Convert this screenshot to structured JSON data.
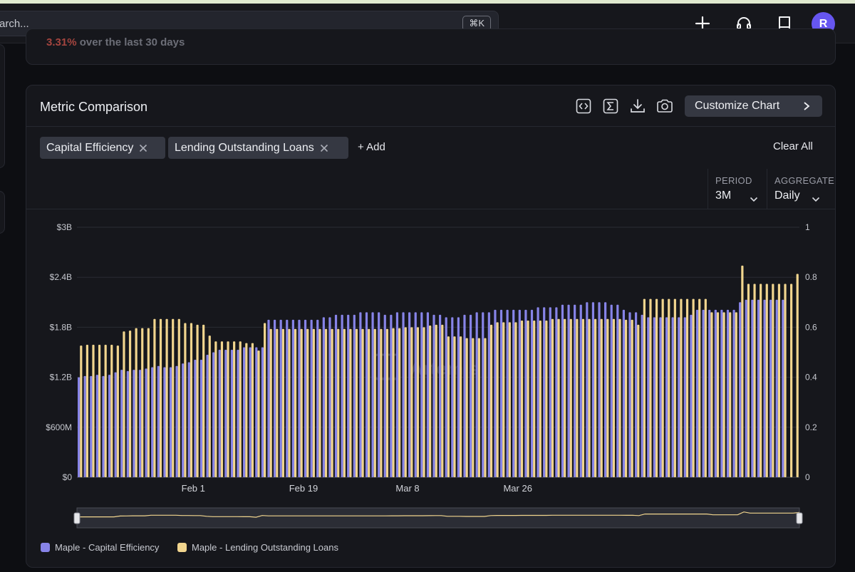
{
  "topbar": {
    "search_placeholder": "arch...",
    "shortcut": "⌘K",
    "avatar_initial": "R",
    "icons": [
      "plus-icon",
      "headset-icon",
      "book-icon"
    ]
  },
  "summary": {
    "change": "3.31%",
    "change_suffix": "over the last 30 days"
  },
  "card": {
    "title": "Metric Comparison",
    "toolbar_icons": [
      "embed-icon",
      "sigma-icon",
      "download-icon",
      "camera-icon"
    ],
    "customize_label": "Customize Chart",
    "metrics": [
      {
        "label": "Capital Efficiency"
      },
      {
        "label": "Lending Outstanding Loans"
      }
    ],
    "add_label": "+ Add",
    "clear_label": "Clear All",
    "period": {
      "label": "PERIOD",
      "value": "3M"
    },
    "aggregate": {
      "label": "AGGREGATE",
      "value": "Daily"
    }
  },
  "colors": {
    "capital_efficiency": "#8784e8",
    "lending_loans": "#f1d58e",
    "negative": "#a5453f",
    "accent": "#6656f0"
  },
  "chart_data": {
    "type": "bar",
    "dual_axis": true,
    "aggregation": "Daily",
    "left_axis": {
      "ticks": [
        "$0",
        "$600M",
        "$1.2B",
        "$1.8B",
        "$2.4B",
        "$3B"
      ],
      "ylim": [
        0,
        3000000000
      ]
    },
    "right_axis": {
      "ticks": [
        "0",
        "0.2",
        "0.4",
        "0.6",
        "0.8",
        "1"
      ],
      "ylim": [
        0,
        1
      ]
    },
    "x_tick_labels": [
      {
        "label": "Feb 1",
        "index": 18
      },
      {
        "label": "Feb 19",
        "index": 36
      },
      {
        "label": "Mar 8",
        "index": 53
      },
      {
        "label": "Mar 26",
        "index": 71
      }
    ],
    "grid": true,
    "legend_position": "bottom-left",
    "watermark": "Artemis",
    "series": [
      {
        "name": "Maple - Capital Efficiency",
        "axis": "right",
        "values": [
          0.4,
          0.405,
          0.405,
          0.41,
          0.405,
          0.41,
          0.42,
          0.43,
          0.425,
          0.43,
          0.43,
          0.435,
          0.44,
          0.445,
          0.44,
          0.44,
          0.445,
          0.455,
          0.46,
          0.47,
          0.47,
          0.49,
          0.5,
          0.51,
          0.51,
          0.51,
          0.51,
          0.52,
          0.52,
          0.52,
          0.52,
          0.63,
          0.63,
          0.63,
          0.63,
          0.63,
          0.63,
          0.63,
          0.63,
          0.63,
          0.64,
          0.64,
          0.65,
          0.65,
          0.65,
          0.65,
          0.66,
          0.66,
          0.66,
          0.66,
          0.65,
          0.65,
          0.66,
          0.66,
          0.66,
          0.66,
          0.66,
          0.66,
          0.65,
          0.65,
          0.64,
          0.64,
          0.64,
          0.65,
          0.65,
          0.66,
          0.66,
          0.66,
          0.67,
          0.67,
          0.67,
          0.67,
          0.67,
          0.67,
          0.67,
          0.68,
          0.68,
          0.68,
          0.68,
          0.69,
          0.69,
          0.69,
          0.69,
          0.7,
          0.7,
          0.7,
          0.7,
          0.69,
          0.69,
          0.67,
          0.66,
          0.66,
          0.65,
          0.64,
          0.64,
          0.64,
          0.64,
          0.64,
          0.64,
          0.64,
          0.65,
          0.67,
          0.67,
          0.67,
          0.67,
          0.67,
          0.67,
          0.67,
          0.7,
          0.71,
          0.71,
          0.71,
          0.71,
          0.71,
          0.71,
          0.71
        ]
      },
      {
        "name": "Maple - Lending Outstanding Loans",
        "axis": "left",
        "values": [
          1580000000,
          1590000000,
          1590000000,
          1590000000,
          1590000000,
          1590000000,
          1580000000,
          1750000000,
          1760000000,
          1790000000,
          1790000000,
          1790000000,
          1900000000,
          1900000000,
          1900000000,
          1900000000,
          1900000000,
          1850000000,
          1850000000,
          1830000000,
          1830000000,
          1700000000,
          1630000000,
          1630000000,
          1630000000,
          1630000000,
          1630000000,
          1610000000,
          1610000000,
          1520000000,
          1850000000,
          1780000000,
          1780000000,
          1780000000,
          1780000000,
          1780000000,
          1780000000,
          1780000000,
          1780000000,
          1780000000,
          1780000000,
          1780000000,
          1780000000,
          1780000000,
          1780000000,
          1780000000,
          1780000000,
          1780000000,
          1780000000,
          1780000000,
          1780000000,
          1790000000,
          1790000000,
          1800000000,
          1800000000,
          1800000000,
          1800000000,
          1820000000,
          1830000000,
          1830000000,
          1690000000,
          1690000000,
          1690000000,
          1670000000,
          1670000000,
          1670000000,
          1670000000,
          1830000000,
          1860000000,
          1860000000,
          1860000000,
          1860000000,
          1880000000,
          1880000000,
          1880000000,
          1880000000,
          1880000000,
          1900000000,
          1900000000,
          1900000000,
          1900000000,
          1900000000,
          1900000000,
          1900000000,
          1900000000,
          1900000000,
          1900000000,
          1900000000,
          1900000000,
          1890000000,
          1890000000,
          1830000000,
          2140000000,
          2140000000,
          2140000000,
          2140000000,
          2140000000,
          2140000000,
          2140000000,
          2140000000,
          2140000000,
          2140000000,
          2140000000,
          1980000000,
          1980000000,
          1980000000,
          1980000000,
          1980000000,
          2540000000,
          2320000000,
          2320000000,
          2320000000,
          2320000000,
          2320000000,
          2320000000,
          2320000000,
          2320000000,
          2440000000
        ]
      }
    ]
  }
}
